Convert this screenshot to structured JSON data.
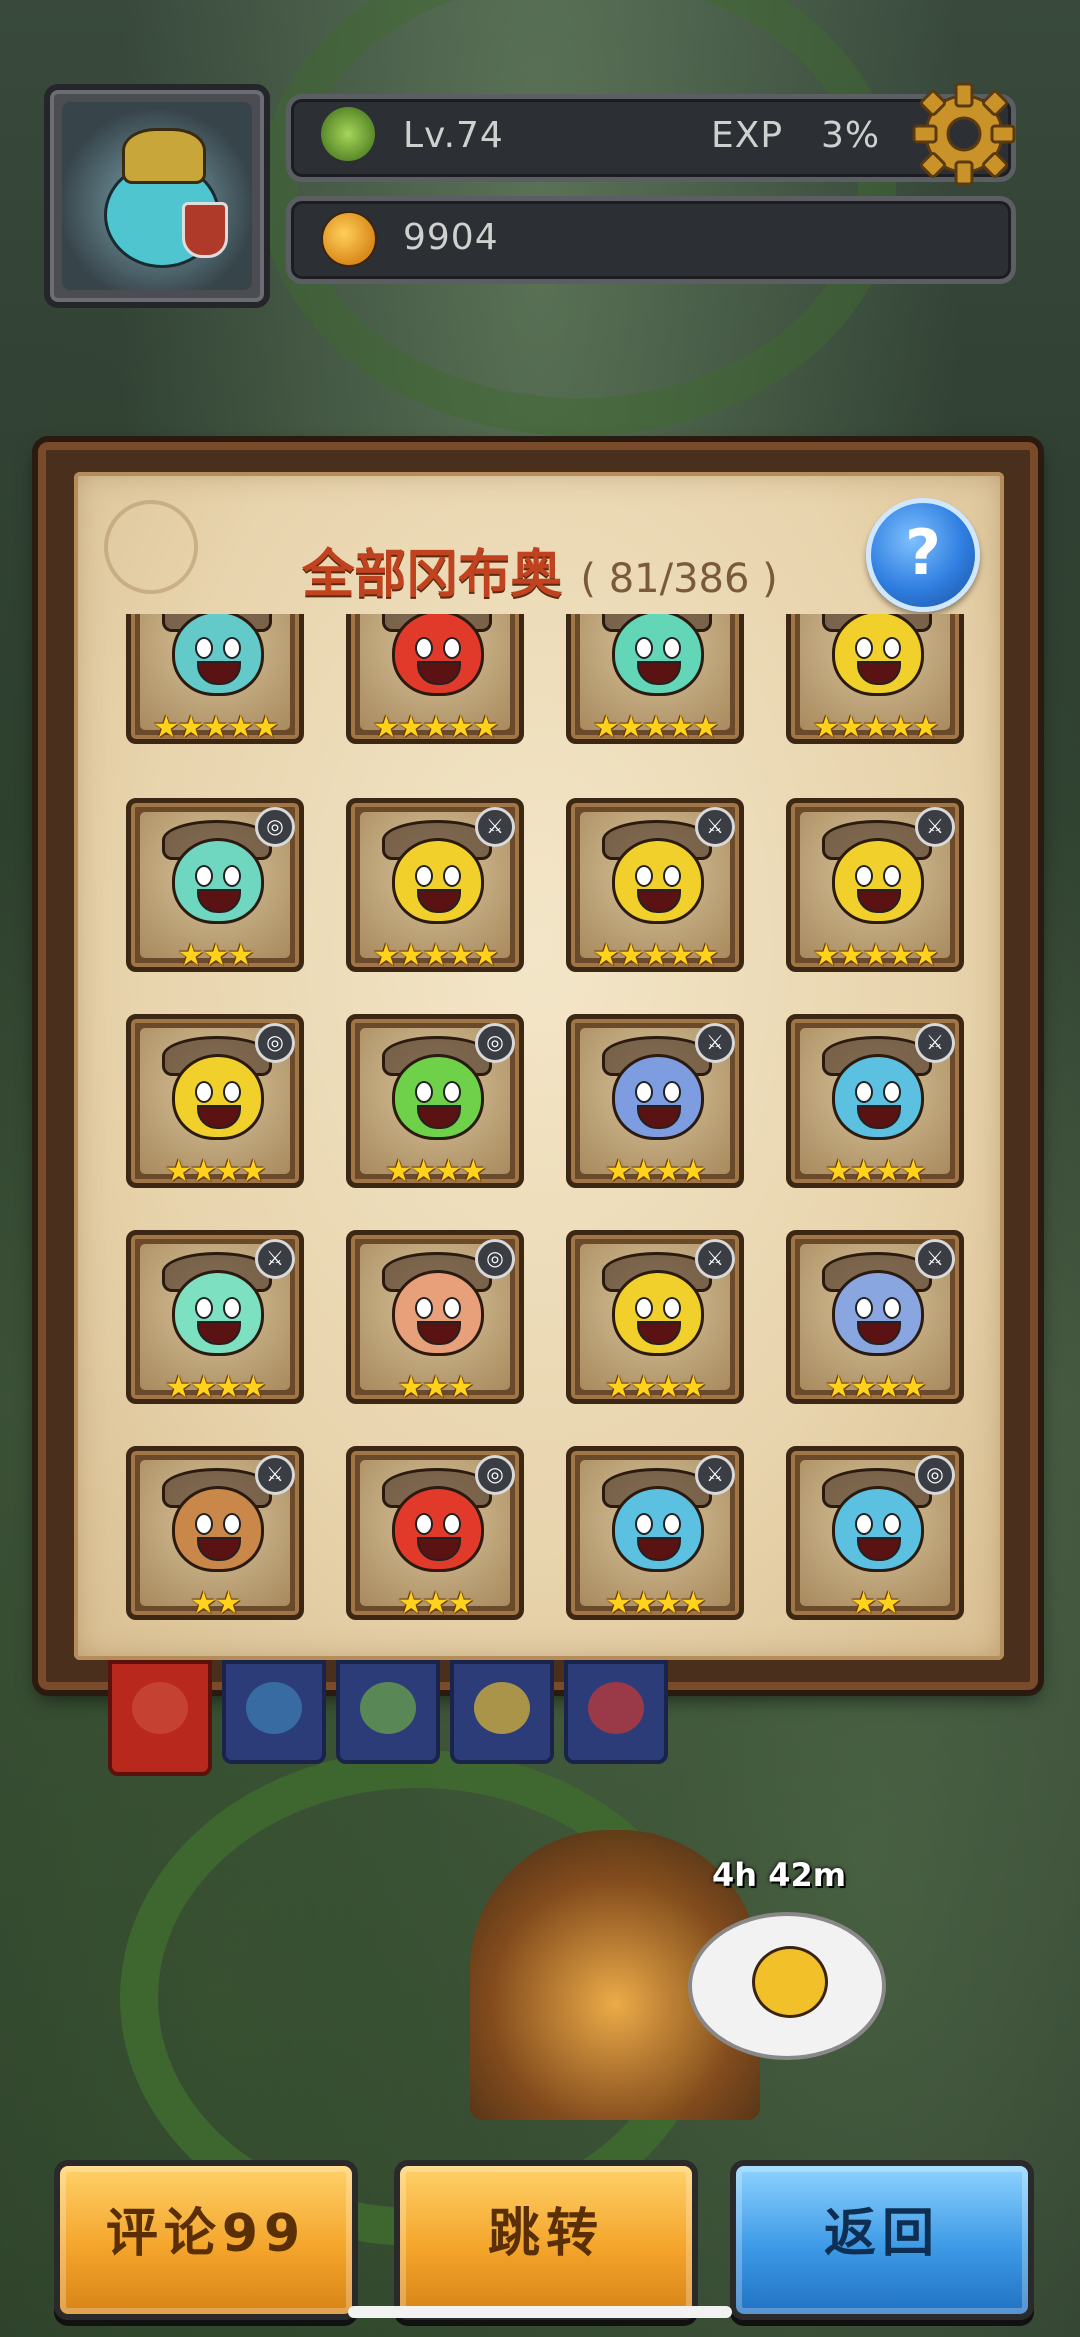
{
  "header": {
    "level_text": "Lv.74",
    "exp_label": "EXP",
    "exp_value": "3%",
    "currency_value": "9904"
  },
  "panel": {
    "title": "全部冈布奥",
    "count": "( 81/386 )",
    "help_label": "?"
  },
  "cards": [
    {
      "color": "#63c9c9",
      "stars": "★★★★★",
      "badge": ""
    },
    {
      "color": "#e23a2a",
      "stars": "★★★★★",
      "badge": ""
    },
    {
      "color": "#63d6b7",
      "stars": "★★★★★",
      "badge": ""
    },
    {
      "color": "#f2d02c",
      "stars": "★★★★★",
      "badge": ""
    },
    {
      "color": "#6fd6c0",
      "stars": "★★★",
      "badge": "◎"
    },
    {
      "color": "#f2d02c",
      "stars": "★★★★★",
      "badge": "⚔"
    },
    {
      "color": "#f2d02c",
      "stars": "★★★★★",
      "badge": "⚔"
    },
    {
      "color": "#f2d02c",
      "stars": "★★★★★",
      "badge": "⚔"
    },
    {
      "color": "#f2d02c",
      "stars": "★★★★",
      "badge": "◎"
    },
    {
      "color": "#6fd04a",
      "stars": "★★★★",
      "badge": "◎"
    },
    {
      "color": "#7d9de0",
      "stars": "★★★★",
      "badge": "⚔"
    },
    {
      "color": "#5cc0e0",
      "stars": "★★★★",
      "badge": "⚔"
    },
    {
      "color": "#7de0c0",
      "stars": "★★★★",
      "badge": "⚔"
    },
    {
      "color": "#e8a07a",
      "stars": "★★★",
      "badge": "◎"
    },
    {
      "color": "#f2d02c",
      "stars": "★★★★",
      "badge": "⚔"
    },
    {
      "color": "#8aa6e0",
      "stars": "★★★★",
      "badge": "⚔"
    },
    {
      "color": "#c9874a",
      "stars": "★★",
      "badge": "⚔"
    },
    {
      "color": "#e23a2a",
      "stars": "★★★",
      "badge": "◎"
    },
    {
      "color": "#5cc0e0",
      "stars": "★★★★",
      "badge": "⚔"
    },
    {
      "color": "#5cc0e0",
      "stars": "★★",
      "badge": "◎"
    }
  ],
  "tabs": [
    {
      "name": "all",
      "color": "#c94a3a"
    },
    {
      "name": "blue",
      "color": "#3e7bb0"
    },
    {
      "name": "green",
      "color": "#6aa04a"
    },
    {
      "name": "yellow",
      "color": "#d6b23a"
    },
    {
      "name": "red",
      "color": "#c03a3a"
    }
  ],
  "timer": "4h 42m",
  "buttons": {
    "comment": "评论99",
    "jump": "跳转",
    "back": "返回"
  }
}
